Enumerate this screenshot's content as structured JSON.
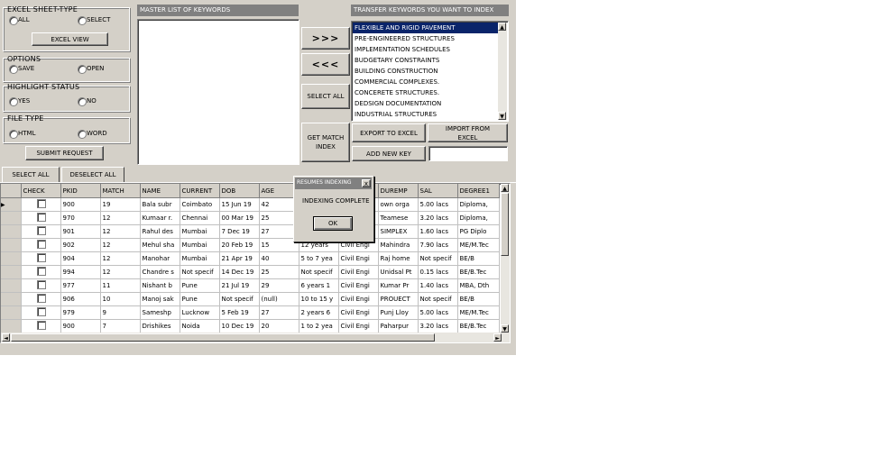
{
  "left_panel": {
    "excel_sheet_type": {
      "title": "EXCEL SHEET-TYPE",
      "options": [
        "ALL",
        "SELECT"
      ]
    },
    "excel_view_button": "EXCEL VIEW",
    "options_group": {
      "title": "OPTIONS",
      "options": [
        "SAVE",
        "OPEN"
      ]
    },
    "highlight_status": {
      "title": "HIGHLIGHT  STATUS",
      "options": [
        "YES",
        "NO"
      ]
    },
    "file_type": {
      "title": "FILE TYPE",
      "options": [
        "HTML",
        "WORD"
      ]
    },
    "submit_button": "SUBMIT REQUEST"
  },
  "master_list": {
    "title": "MASTER LIST OF KEYWORDS",
    "items": []
  },
  "transfer_buttons": {
    "add": ">>>",
    "remove": "<<<",
    "select_all": "SELECT ALL",
    "get_match": "GET MATCH INDEX"
  },
  "transfer_list": {
    "title": "TRANSFER KEYWORDS YOU WANT TO INDEX",
    "items": [
      "FLEXIBLE AND RIGID PAVEMENT",
      "PRE-ENGINEERED STRUCTURES",
      "IMPLEMENTATION SCHEDULES",
      "BUDGETARY CONSTRAINTS",
      "BUILDING CONSTRUCTION",
      "COMMERCIAL COMPLEXES.",
      "CONCERETE STRUCTURES.",
      "DEDSIGN DOCUMENTATION",
      "INDUSTRIAL STRUCTURES"
    ],
    "selected_index": 0
  },
  "right_buttons": {
    "export": "EXPORT TO EXCEL",
    "import": "IMPORT FROM EXCEL",
    "add_new": "ADD NEW KEY",
    "new_key_value": ""
  },
  "tabs": [
    "SELECT ALL",
    "DESELECT ALL"
  ],
  "grid": {
    "columns": [
      "CHECK",
      "PKID",
      "MATCH",
      "NAME",
      "CURRENT",
      "DOB",
      "AGE",
      "",
      "",
      "DUREMP",
      "SAL",
      "DEGREE1"
    ],
    "rows": [
      [
        "",
        "900",
        "19",
        "Bala subr",
        "Coimbato",
        "15 Jun 19",
        "42",
        "",
        "",
        "own orga",
        "5.00 lacs",
        "Diploma,"
      ],
      [
        "",
        "970",
        "12",
        "Kumaar r.",
        "Chennai",
        "00 Mar 19",
        "25",
        "",
        "",
        "Teamese",
        "3.20 lacs",
        "Diploma,"
      ],
      [
        "",
        "901",
        "12",
        "Rahul des",
        "Mumbai",
        "7 Dec 19",
        "27",
        "",
        "",
        "SIMPLEX",
        "1.60 lacs",
        "PG Diplo"
      ],
      [
        "",
        "902",
        "12",
        "Mehul sha",
        "Mumbai",
        "20 Feb 19",
        "15",
        "12 years",
        "Civil Engi",
        "Mahindra",
        "7.90 lacs",
        "ME/M.Tec"
      ],
      [
        "",
        "904",
        "12",
        "Manohar",
        "Mumbai",
        "21 Apr 19",
        "40",
        "5 to 7 yea",
        "Civil Engi",
        "Raj home",
        "Not specif",
        "BE/B"
      ],
      [
        "",
        "994",
        "12",
        "Chandre s",
        "Not specif",
        "14 Dec 19",
        "25",
        "Not specif",
        "Civil Engi",
        "Unidsal Pt",
        "0.15 lacs",
        "BE/B.Tec"
      ],
      [
        "",
        "977",
        "11",
        "Nishant b",
        "Pune",
        "21 Jul 19",
        "29",
        "6 years 1",
        "Civil Engi",
        "Kumar Pr",
        "1.40 lacs",
        "MBA, Dth"
      ],
      [
        "",
        "906",
        "10",
        "Manoj sak",
        "Pune",
        "Not specif",
        "(null)",
        "10 to 15 y",
        "Civil Engi",
        "PROUECT",
        "Not specif",
        "BE/B"
      ],
      [
        "",
        "979",
        "9",
        "Sameshp",
        "Lucknow",
        "5 Feb 19",
        "27",
        "2 years 6",
        "Civil Engi",
        "Punj Lloy",
        "5.00 lacs",
        "ME/M.Tec"
      ],
      [
        "",
        "900",
        "7",
        "Drishikes",
        "Noida",
        "10 Dec 19",
        "20",
        "1 to 2 yea",
        "Civil Engi",
        "Paharpur",
        "3.20 lacs",
        "BE/B.Tec"
      ]
    ]
  },
  "dialog": {
    "title": "RESUMES INDEXING",
    "message": "INDEXING COMPLETE",
    "ok": "OK",
    "close": "x"
  },
  "colors": {
    "face": "#d4d0c8",
    "caption": "#808080",
    "selection": "#0a246a"
  }
}
